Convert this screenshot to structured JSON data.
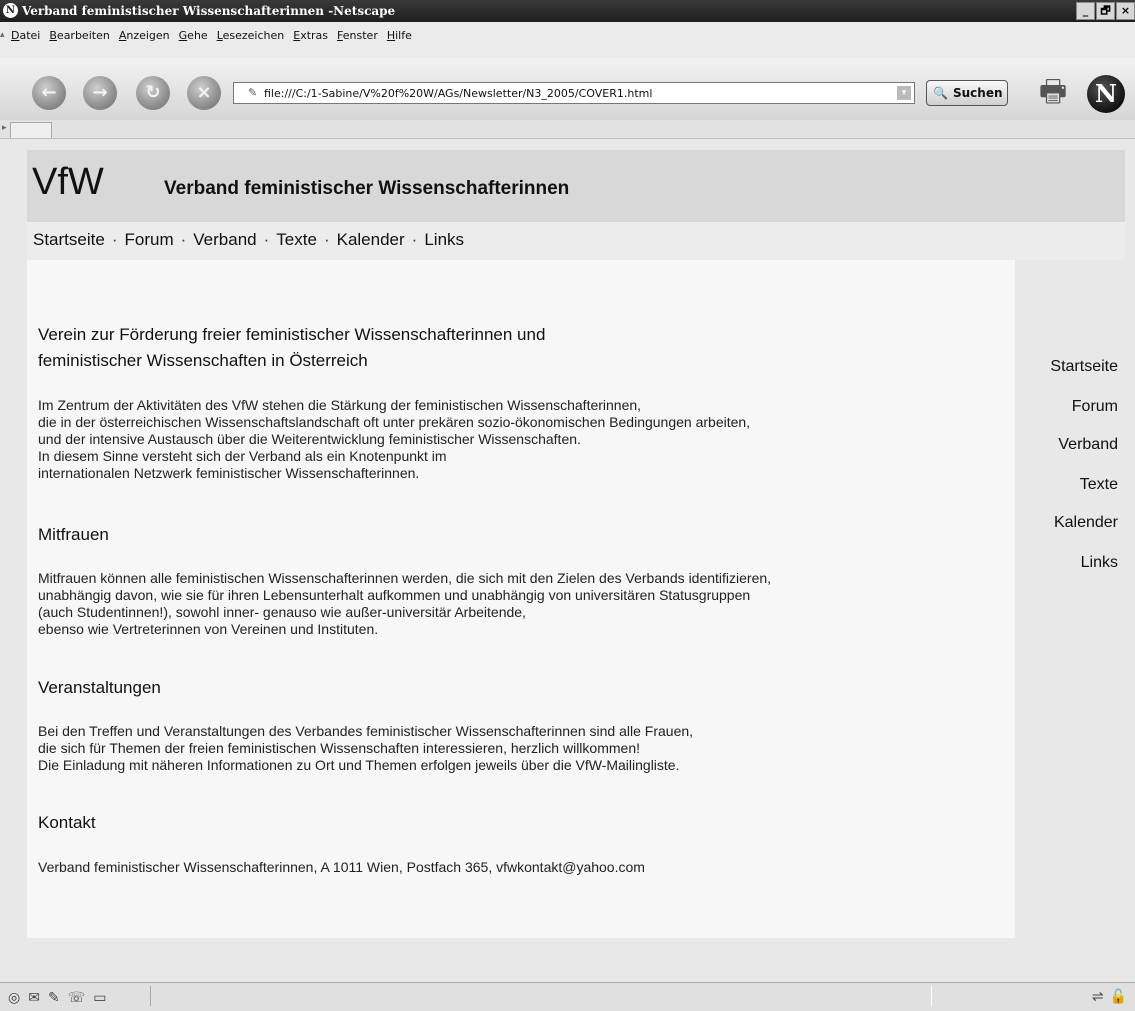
{
  "window": {
    "title": "Verband feministischer Wissenschafterinnen -Netscape",
    "controls": [
      "_",
      "🗗",
      "×"
    ]
  },
  "menu": [
    "Datei",
    "Bearbeiten",
    "Anzeigen",
    "Gehe",
    "Lesezeichen",
    "Extras",
    "Fenster",
    "Hilfe"
  ],
  "toolbar": {
    "url": "file:///C:/1-Sabine/V%20f%20W/AGs/Newsletter/N3_2005/COVER1.html",
    "search_label": "Suchen",
    "logo_letter": "N"
  },
  "site": {
    "logo": "VfW",
    "title": "Verband feministischer Wissenschafterinnen",
    "topnav": [
      "Startseite",
      "Forum",
      "Verband",
      "Texte",
      "Kalender",
      "Links"
    ],
    "sidenav": [
      "Startseite",
      "Forum",
      "Verband",
      "Texte",
      "Kalender",
      "Links"
    ]
  },
  "content": {
    "main_heading": [
      "Verein zur Förderung freier feministischer Wissenschafterinnen und",
      "feministischer Wissenschaften in Österreich"
    ],
    "intro": [
      "Im Zentrum der Aktivitäten des VfW stehen die Stärkung der feministischen Wissenschafterinnen,",
      "die in der österreichischen Wissenschaftslandschaft oft unter prekären sozio-ökonomischen Bedingungen arbeiten,",
      "und der intensive Austausch über die Weiterentwicklung feministischer Wissenschaften.",
      "In diesem Sinne versteht sich der Verband als ein Knotenpunkt im",
      "internationalen Netzwerk feministischer Wissenschafterinnen."
    ],
    "mitfrauen_heading": "Mitfrauen",
    "mitfrauen": [
      "Mitfrauen können alle feministischen Wissenschafterinnen werden, die sich mit den Zielen des Verbands identifizieren,",
      "unabhängig davon, wie sie für ihren Lebensunterhalt aufkommen und unabhängig von universitären Statusgruppen",
      "(auch Studentinnen!), sowohl inner- genauso wie außer-universitär Arbeitende,",
      "ebenso wie Vertreterinnen von Vereinen und Instituten."
    ],
    "veranstaltungen_heading": "Veranstaltungen",
    "veranstaltungen": [
      "Bei den  Treffen und Veranstaltungen des Verbandes feministischer Wissenschafterinnen sind alle Frauen,",
      "die sich für Themen der freien feministischen Wissenschaften interessieren, herzlich willkommen!",
      "Die Einladung mit näheren Informationen zu Ort und Themen erfolgen jeweils über die VfW-Mailingliste."
    ],
    "kontakt_heading": "Kontakt",
    "kontakt": "Verband feministischer Wissenschafterinnen, A 1011 Wien, Postfach 365, vfwkontakt@yahoo.com"
  }
}
